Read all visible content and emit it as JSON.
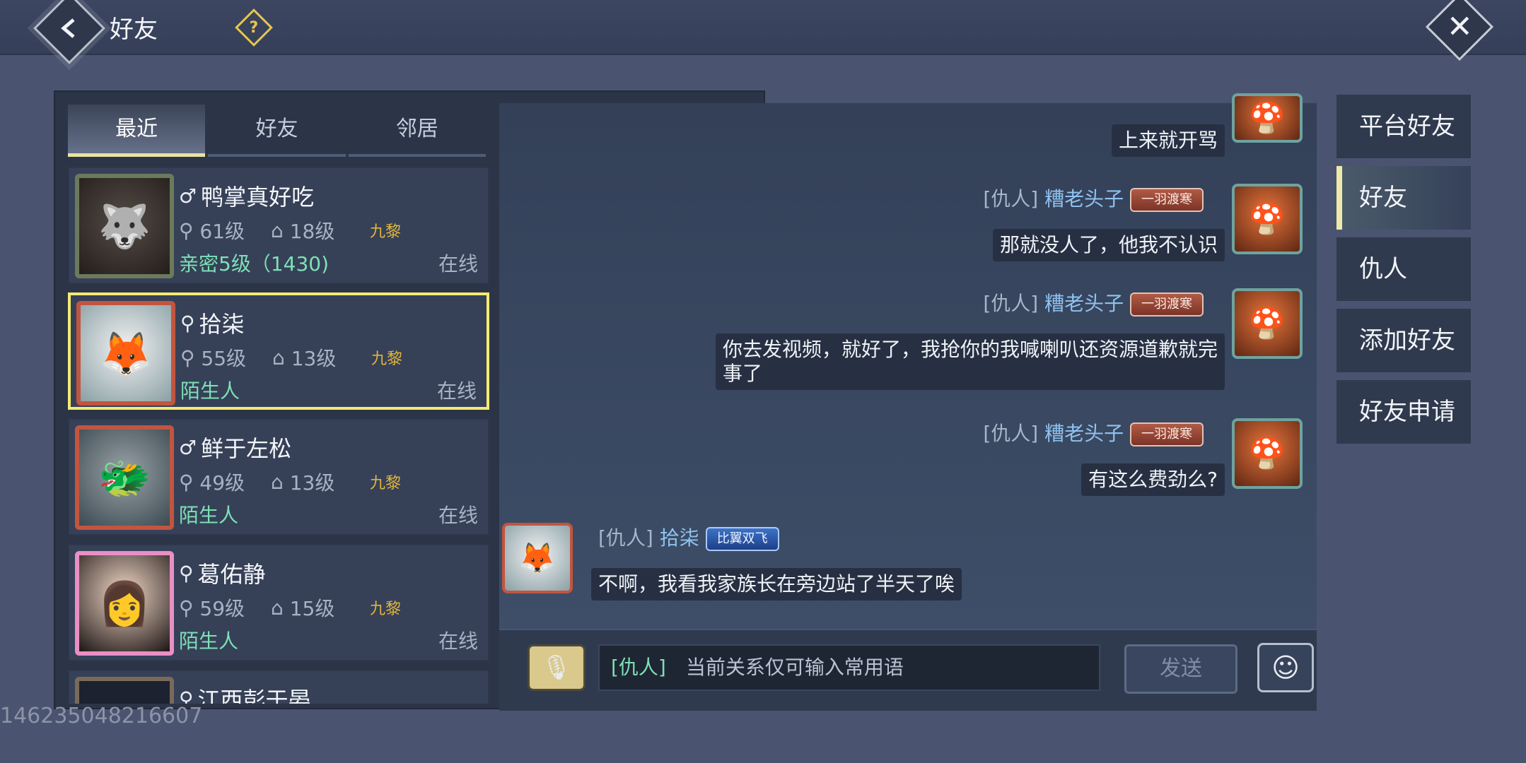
{
  "header": {
    "title": "好友"
  },
  "tabs": [
    {
      "label": "最近",
      "active": true
    },
    {
      "label": "好友",
      "active": false
    },
    {
      "label": "邻居",
      "active": false
    }
  ],
  "friends": [
    {
      "gender": "♂",
      "name": "鸭掌真好吃",
      "level": "61级",
      "fort_level": "18级",
      "server": "九黎",
      "relation": "亲密5级（1430)",
      "status": "在线",
      "avatar_icon": "wolf-portrait"
    },
    {
      "gender": "⚲",
      "name": "拾柒",
      "level": "55级",
      "fort_level": "13级",
      "server": "九黎",
      "relation": "陌生人",
      "status": "在线",
      "avatar_icon": "fox-portrait"
    },
    {
      "gender": "♂",
      "name": "鲜于左松",
      "level": "49级",
      "fort_level": "13级",
      "server": "九黎",
      "relation": "陌生人",
      "status": "在线",
      "avatar_icon": "beast-portrait"
    },
    {
      "gender": "⚲",
      "name": "葛佑静",
      "level": "59级",
      "fort_level": "15级",
      "server": "九黎",
      "relation": "陌生人",
      "status": "在线",
      "avatar_icon": "girl-portrait"
    },
    {
      "gender": "⚲",
      "name": "江西彭于晏",
      "level": "",
      "fort_level": "",
      "server": "",
      "relation": "",
      "status": "",
      "avatar_icon": "dark-portrait"
    }
  ],
  "chat": {
    "messages": [
      {
        "side": "right",
        "tag": "",
        "sender": "",
        "badge": "",
        "text": "上来就开骂"
      },
      {
        "side": "right",
        "tag": "[仇人]",
        "sender": "糟老头子",
        "badge": "一羽渡寒",
        "text": "那就没人了，他我不认识"
      },
      {
        "side": "right",
        "tag": "[仇人]",
        "sender": "糟老头子",
        "badge": "一羽渡寒",
        "text": "你去发视频，就好了，我抢你的我喊喇叭还资源道歉就完事了"
      },
      {
        "side": "right",
        "tag": "[仇人]",
        "sender": "糟老头子",
        "badge": "一羽渡寒",
        "text": "有这么费劲么?"
      },
      {
        "side": "left",
        "tag": "[仇人]",
        "sender": "拾柒",
        "badge": "比翼双飞",
        "text": "不啊，我看我家族长在旁边站了半天了唉"
      }
    ],
    "input": {
      "prefix": "[仇人]",
      "placeholder": "当前关系仅可输入常用语"
    },
    "send_label": "发送"
  },
  "side_menu": [
    {
      "label": "平台好友",
      "active": false
    },
    {
      "label": "好友",
      "active": true
    },
    {
      "label": "仇人",
      "active": false
    },
    {
      "label": "添加好友",
      "active": false
    },
    {
      "label": "好友申请",
      "active": false
    }
  ],
  "watermark": "146235048216607",
  "colors": {
    "accent_yellow": "#f5ea73",
    "relation_green": "#7ee0b5",
    "sender_blue": "#8fc2ef"
  }
}
